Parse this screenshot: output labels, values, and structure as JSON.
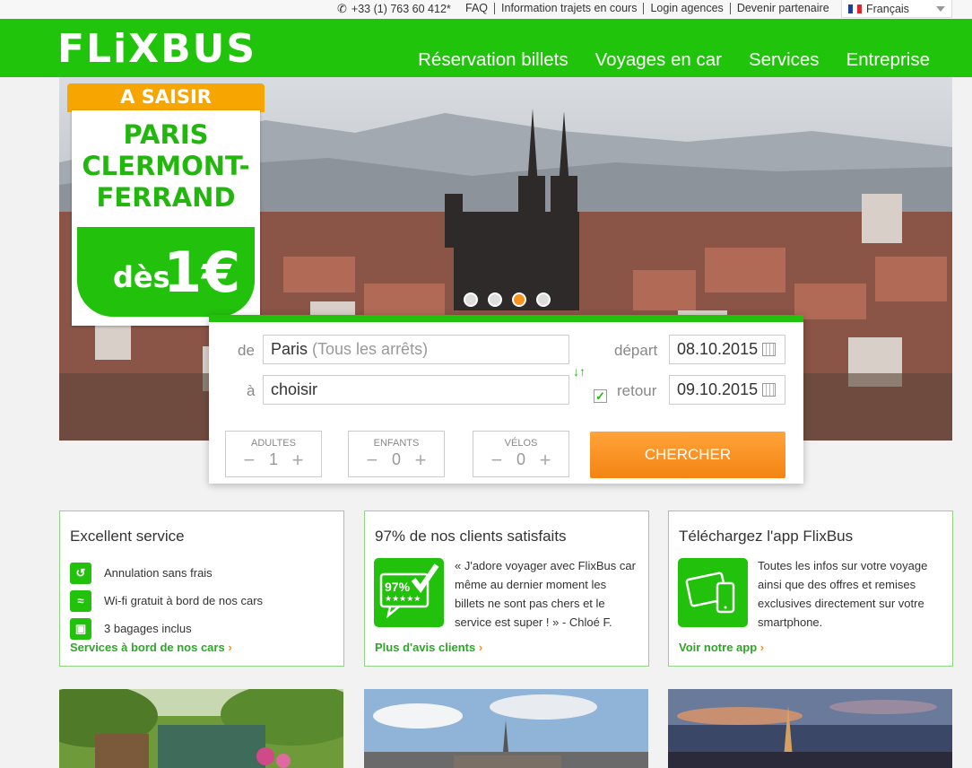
{
  "topbar": {
    "phone": "+33 (1) 763 60 412*",
    "links": [
      "FAQ",
      "Information trajets en cours",
      "Login agences",
      "Devenir partenaire"
    ],
    "language": "Français",
    "flag_colors": [
      "#1f3e9a",
      "#ffffff",
      "#e1252d"
    ]
  },
  "brand": {
    "logo": "FLiXBUS",
    "accent": "#20c40a",
    "cta_color": "#f48412"
  },
  "nav": [
    "Réservation billets",
    "Voyages en car",
    "Services",
    "Entreprise"
  ],
  "promo": {
    "ribbon": "A SAISIR",
    "cities": [
      "PARIS",
      "CLERMONT-",
      "FERRAND"
    ],
    "from": "dès",
    "amount": "1€"
  },
  "carousel": {
    "slides": 4,
    "active_index": 3
  },
  "search": {
    "from_label": "de",
    "from_value": "Paris",
    "from_hint": "(Tous les arrêts)",
    "to_label": "à",
    "to_value": "choisir",
    "swap_icon": "swap-arrows-icon",
    "departure_label": "départ",
    "departure_date": "08.10.2015",
    "return_checked": true,
    "return_label": "retour",
    "return_date": "09.10.2015",
    "counters": [
      {
        "label": "ADULTES",
        "value": "1"
      },
      {
        "label": "ENFANTS",
        "value": "0"
      },
      {
        "label": "VÉLOS",
        "value": "0"
      }
    ],
    "minus": "−",
    "plus": "+",
    "submit": "CHERCHER"
  },
  "cards": {
    "service": {
      "title": "Excellent service",
      "items": [
        {
          "icon": "cancel-icon",
          "text": "Annulation sans frais"
        },
        {
          "icon": "wifi-icon",
          "text": "Wi-fi gratuit à bord de nos cars"
        },
        {
          "icon": "luggage-icon",
          "text": "3 bagages inclus"
        }
      ],
      "link": "Services à bord de nos cars"
    },
    "reviews": {
      "title": "97% de nos clients satisfaits",
      "badge_percent": "97%",
      "badge_stars": "★★★★★",
      "quote": "« J'adore voyager avec FlixBus car même au dernier moment les billets ne sont pas chers et le service est super ! » - Chloé F.",
      "link": "Plus d'avis clients"
    },
    "app": {
      "title": "Téléchargez l'app FlixBus",
      "text": "Toutes les infos sur votre voyage ainsi que des offres et remises exclusives directement sur votre smartphone.",
      "link": "Voir notre app"
    }
  },
  "link_arrow": "›"
}
